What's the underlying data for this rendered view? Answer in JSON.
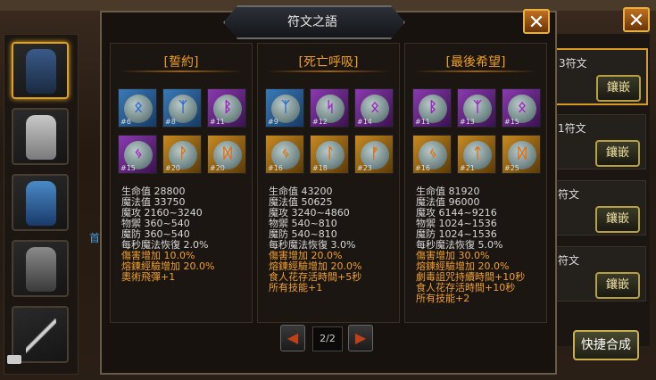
{
  "dialog": {
    "title": "符文之語",
    "close_symbol": "✕",
    "pager": {
      "label": "2/2",
      "prev_symbol": "◀",
      "next_symbol": "▶"
    }
  },
  "outer_close_symbol": "✕",
  "side_letter": "首",
  "right_rows": [
    {
      "label": "3符文",
      "button": "鑲嵌"
    },
    {
      "label": "1符文",
      "button": "鑲嵌"
    },
    {
      "label": "符文",
      "button": "鑲嵌"
    },
    {
      "label": "符文",
      "button": "鑲嵌"
    }
  ],
  "quick_button": "快捷合成",
  "columns": [
    {
      "title": "[誓約]",
      "runes": [
        {
          "color": "blue",
          "glyph": "ᛟ",
          "num": "#6"
        },
        {
          "color": "blue",
          "glyph": "ᛉ",
          "num": "#8"
        },
        {
          "color": "purple",
          "glyph": "ᛒ",
          "num": "#11"
        },
        {
          "color": "purple",
          "glyph": "ᛃ",
          "num": "#15"
        },
        {
          "color": "gold",
          "glyph": "ᚹ",
          "num": "#20"
        },
        {
          "color": "gold",
          "glyph": "ᛞ",
          "num": "#20"
        }
      ],
      "stats": [
        {
          "text": "生命值  28800",
          "color": "white"
        },
        {
          "text": "魔法值  33750",
          "color": "white"
        },
        {
          "text": "魔攻  2160~3240",
          "color": "white"
        },
        {
          "text": "物禦  360~540",
          "color": "white"
        },
        {
          "text": "魔防  360~540",
          "color": "white"
        },
        {
          "text": "每秒魔法恢復 2.0%",
          "color": "white"
        },
        {
          "text": "傷害增加 10.0%",
          "color": "orange"
        },
        {
          "text": "熔鍊經驗增加 20.0%",
          "color": "orange"
        },
        {
          "text": "奧術飛彈+1",
          "color": "orange"
        }
      ]
    },
    {
      "title": "[死亡呼吸]",
      "runes": [
        {
          "color": "blue",
          "glyph": "ᛉ",
          "num": "#9"
        },
        {
          "color": "purple",
          "glyph": "ᛋ",
          "num": "#12"
        },
        {
          "color": "purple",
          "glyph": "ᛟ",
          "num": "#14"
        },
        {
          "color": "gold",
          "glyph": "ᛃ",
          "num": "#16"
        },
        {
          "color": "gold",
          "glyph": "ᛚ",
          "num": "#18"
        },
        {
          "color": "gold",
          "glyph": "ᚠ",
          "num": "#23"
        }
      ],
      "stats": [
        {
          "text": "生命值  43200",
          "color": "white"
        },
        {
          "text": "魔法值  50625",
          "color": "white"
        },
        {
          "text": "魔攻  3240~4860",
          "color": "white"
        },
        {
          "text": "物禦  540~810",
          "color": "white"
        },
        {
          "text": "魔防  540~810",
          "color": "white"
        },
        {
          "text": "每秒魔法恢復 3.0%",
          "color": "white"
        },
        {
          "text": "傷害增加 20.0%",
          "color": "orange"
        },
        {
          "text": "熔鍊經驗增加 20.0%",
          "color": "orange"
        },
        {
          "text": "食人花存活時間+5秒",
          "color": "orange"
        },
        {
          "text": "所有技能+1",
          "color": "orange"
        }
      ]
    },
    {
      "title": "[最後希望]",
      "runes": [
        {
          "color": "purple",
          "glyph": "ᛒ",
          "num": "#11"
        },
        {
          "color": "purple",
          "glyph": "ᛉ",
          "num": "#13"
        },
        {
          "color": "purple",
          "glyph": "ᛟ",
          "num": "#15"
        },
        {
          "color": "gold",
          "glyph": "ᛃ",
          "num": "#16"
        },
        {
          "color": "gold",
          "glyph": "ᛏ",
          "num": "#21"
        },
        {
          "color": "gold",
          "glyph": "ᛞ",
          "num": "#25"
        }
      ],
      "stats": [
        {
          "text": "生命值  81920",
          "color": "white"
        },
        {
          "text": "魔法值  96000",
          "color": "white"
        },
        {
          "text": "魔攻  6144~9216",
          "color": "white"
        },
        {
          "text": "物禦  1024~1536",
          "color": "white"
        },
        {
          "text": "魔防  1024~1536",
          "color": "white"
        },
        {
          "text": "每秒魔法恢復 5.0%",
          "color": "white"
        },
        {
          "text": "傷害增加 30.0%",
          "color": "orange"
        },
        {
          "text": "熔鍊經驗增加 20.0%",
          "color": "orange"
        },
        {
          "text": "劇毒詛咒持續時間+10秒",
          "color": "orange"
        },
        {
          "text": "食人花存活時間+10秒",
          "color": "orange"
        },
        {
          "text": "所有技能+2",
          "color": "orange"
        }
      ]
    }
  ]
}
